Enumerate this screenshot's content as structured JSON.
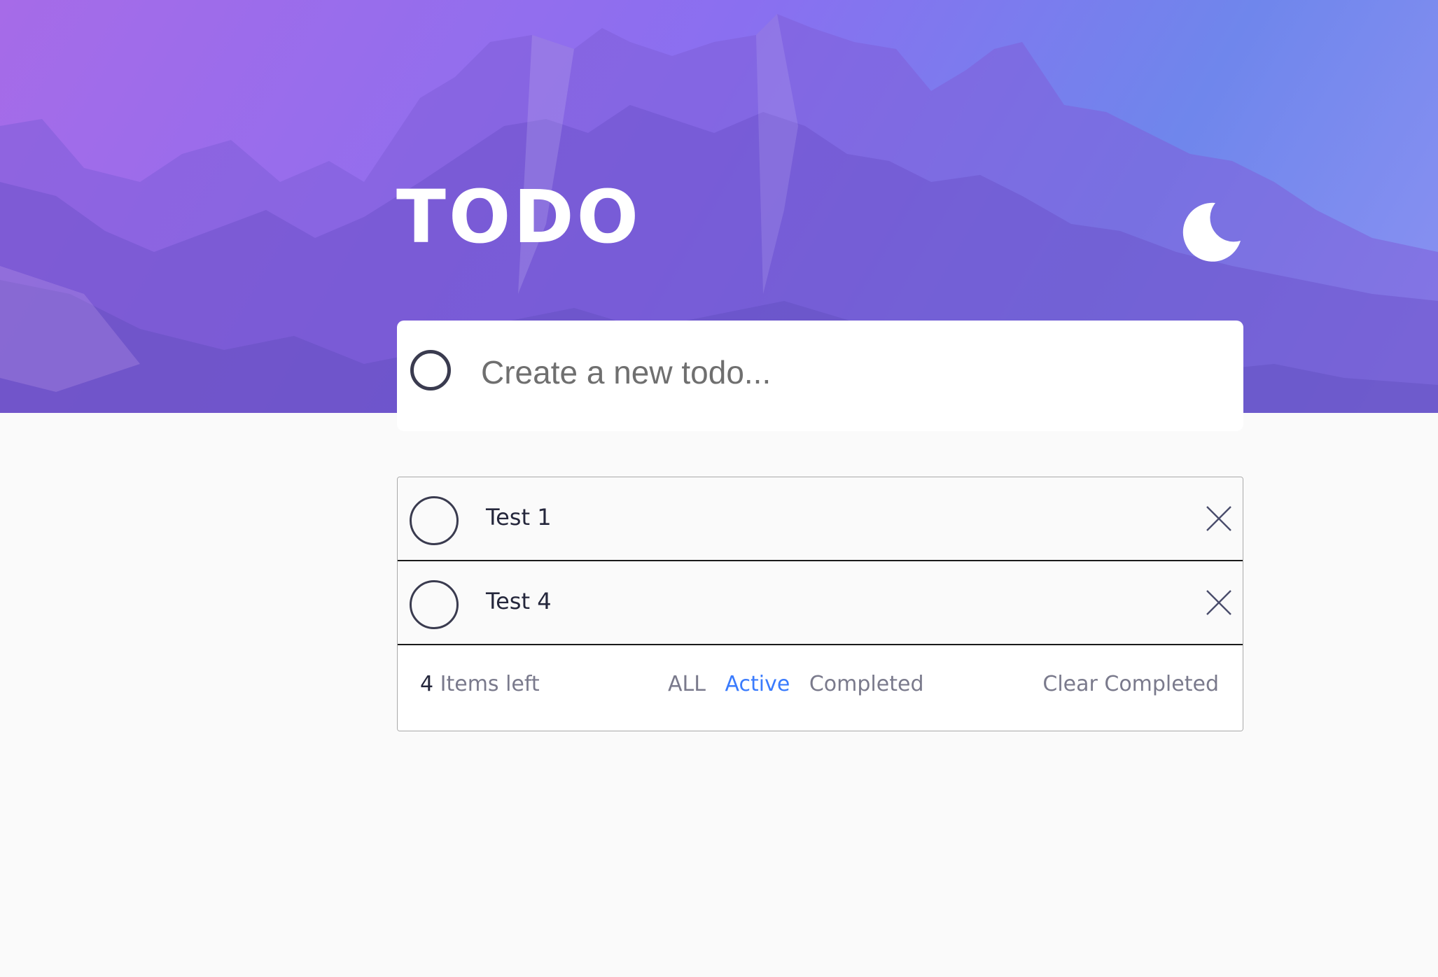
{
  "app": {
    "title": "TODO"
  },
  "theme": {
    "toggle_icon": "moon-icon"
  },
  "new_todo": {
    "placeholder": "Create a new todo...",
    "value": ""
  },
  "todos": [
    {
      "text": "Test 1",
      "completed": false
    },
    {
      "text": "Test 4",
      "completed": false
    }
  ],
  "footer": {
    "count": "4",
    "items_left_label": " Items left",
    "filters": {
      "all": "ALL",
      "active": "Active",
      "completed": "Completed"
    },
    "active_filter": "active",
    "clear_completed": "Clear Completed"
  },
  "colors": {
    "accent": "#3a7bfd",
    "gradient_start": "#a66be8",
    "gradient_end": "#6f86ec",
    "text_dark": "#25273c",
    "text_muted": "#7a7a8c"
  }
}
